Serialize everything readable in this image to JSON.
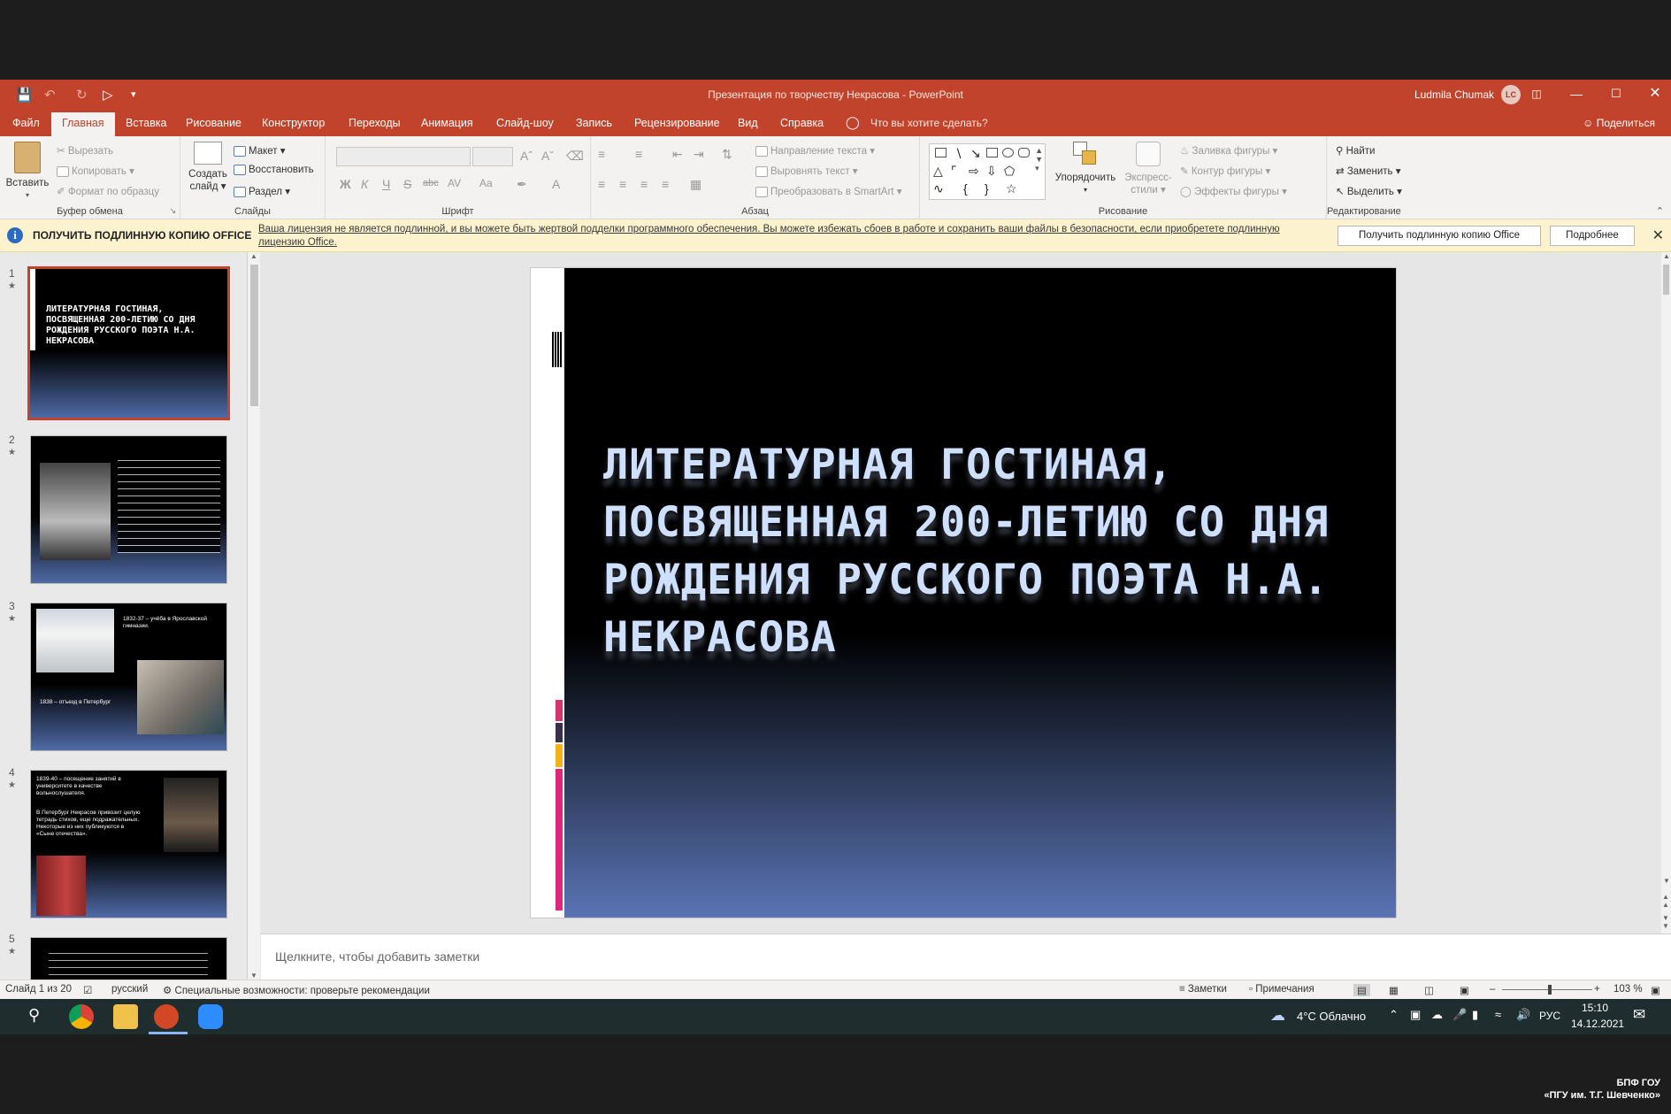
{
  "window": {
    "title": "Презентация по творчеству Некрасова  -  PowerPoint",
    "user_name": "Ludmila Chumak",
    "user_initials": "LC"
  },
  "tabs": [
    "Файл",
    "Главная",
    "Вставка",
    "Рисование",
    "Конструктор",
    "Переходы",
    "Анимация",
    "Слайд-шоу",
    "Запись",
    "Рецензирование",
    "Вид",
    "Справка"
  ],
  "active_tab": "Главная",
  "tell_me": "Что вы хотите сделать?",
  "share": "Поделиться",
  "ribbon": {
    "clipboard": {
      "label": "Буфер обмена",
      "paste": "Вставить",
      "cut": "Вырезать",
      "copy": "Копировать",
      "format_painter": "Формат по образцу"
    },
    "slides": {
      "label": "Слайды",
      "new_slide_1": "Создать",
      "new_slide_2": "слайд",
      "layout": "Макет",
      "reset": "Восстановить",
      "section": "Раздел"
    },
    "font": {
      "label": "Шрифт",
      "bold": "Ж",
      "italic": "К",
      "underline": "Ч",
      "strike": "S",
      "spacing": "abc",
      "spacing2": "AV",
      "case": "Aa"
    },
    "paragraph": {
      "label": "Абзац",
      "text_direction": "Направление текста",
      "align_text": "Выровнять текст",
      "smartart": "Преобразовать в SmartArt"
    },
    "drawing": {
      "label": "Рисование",
      "arrange": "Упорядочить",
      "quick_styles_1": "Экспресс-",
      "quick_styles_2": "стили",
      "shape_fill": "Заливка фигуры",
      "shape_outline": "Контур фигуры",
      "shape_effects": "Эффекты фигуры"
    },
    "editing": {
      "label": "Редактирование",
      "find": "Найти",
      "replace": "Заменить",
      "select": "Выделить"
    }
  },
  "warning": {
    "title": "ПОЛУЧИТЬ ПОДЛИННУЮ КОПИЮ OFFICE",
    "text": "Ваша лицензия не является подлинной, и вы можете быть жертвой подделки программного обеспечения. Вы можете избежать сбоев в работе и сохранить ваши файлы в безопасности, если приобретете подлинную лицензию Office.",
    "btn_get": "Получить подлинную копию Office",
    "btn_more": "Подробнее"
  },
  "thumbnails": [
    {
      "num": "1",
      "title": "ЛИТЕРАТУРНАЯ ГОСТИНАЯ, ПОСВЯЩЕННАЯ 200-ЛЕТИЮ СО ДНЯ РОЖДЕНИЯ РУССКОГО ПОЭТА Н.А. НЕКРАСОВА"
    },
    {
      "num": "2"
    },
    {
      "num": "3",
      "text_a": "1832-37 – учёба в Ярославской гимназии.",
      "text_b": "1838 – отъезд в Петербург"
    },
    {
      "num": "4",
      "text_a": "1839-40 – посещение занятий в университете в качестве вольнослушателя.",
      "text_b": "В Петербург Некрасов привозит целую тетрадь стихов, еще подражательных. Некоторые из них публикуются в «Сыне отечества»."
    },
    {
      "num": "5"
    }
  ],
  "slide": {
    "title": "ЛИТЕРАТУРНАЯ ГОСТИНАЯ, ПОСВЯЩЕННАЯ 200-ЛЕТИЮ СО ДНЯ РОЖДЕНИЯ РУССКОГО ПОЭТА Н.А. НЕКРАСОВА"
  },
  "notes_placeholder": "Щелкните, чтобы добавить заметки",
  "status": {
    "slide_info": "Слайд 1 из 20",
    "language": "русский",
    "accessibility": "Специальные возможности: проверьте рекомендации",
    "notes": "Заметки",
    "comments": "Примечания",
    "zoom": "103 %"
  },
  "taskbar": {
    "weather": "4°C  Облачно",
    "lang": "РУС",
    "time": "15:10",
    "date": "14.12.2021"
  },
  "watermark": {
    "line1": "БПФ ГОУ",
    "line2": "«ПГУ им. Т.Г. Шевченко»"
  },
  "colors": {
    "accent": "#c1432b",
    "slide_gradient_bottom": "#5a74b4",
    "warning_bg": "#fcf2ce"
  }
}
